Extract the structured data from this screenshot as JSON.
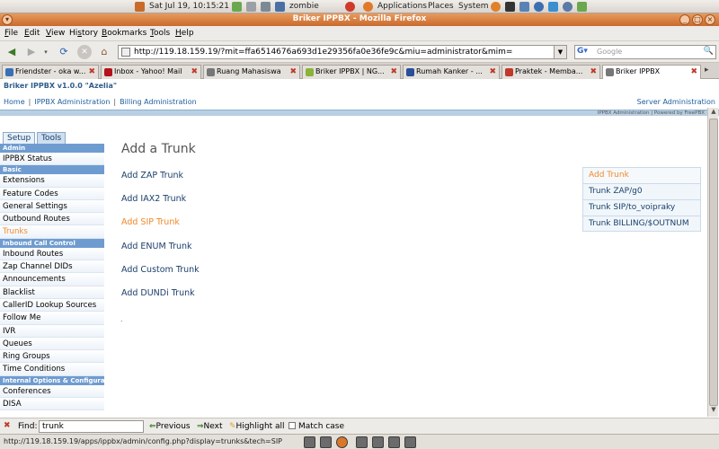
{
  "gnome_panel": {
    "clock": "Sat Jul 19, 10:15:21",
    "user": "zombie",
    "menus": [
      "Applications",
      "Places",
      "System"
    ]
  },
  "window": {
    "title": "Briker IPPBX - Mozilla Firefox"
  },
  "menubar": [
    "File",
    "Edit",
    "View",
    "History",
    "Bookmarks",
    "Tools",
    "Help"
  ],
  "menubar_mnemonics": [
    "F",
    "E",
    "V",
    "s",
    "B",
    "T",
    "H"
  ],
  "navbar": {
    "url": "http://119.18.159.19/?mit=ffa6514676a693d1e29356fa0e36fe9c&miu=administrator&mim=",
    "search_placeholder": "Google"
  },
  "tabs": [
    {
      "label": "Friendster - oka w...",
      "favicon_color": "#3a6fb5"
    },
    {
      "label": "Inbox - Yahoo! Mail",
      "favicon_color": "#b5121b"
    },
    {
      "label": "Ruang Mahasiswa",
      "favicon_color": "#777777"
    },
    {
      "label": "Briker IPPBX | NG...",
      "favicon_color": "#8bb33a"
    },
    {
      "label": "Rumah Kanker - ...",
      "favicon_color": "#2a4e9a"
    },
    {
      "label": "Praktek - Memba...",
      "favicon_color": "#c0392b"
    },
    {
      "label": "Briker IPPBX",
      "favicon_color": "#777777",
      "active": true
    }
  ],
  "page": {
    "brand": "Briker IPPBX v1.0.0 \"Azelia\"",
    "topnav": [
      "Home",
      "IPPBX Administration",
      "Billing Administration"
    ],
    "server_admin": "Server Administration",
    "powered_by": "IPPBX Administration | Powered by FreePBX",
    "left_tabs": [
      "Setup",
      "Tools"
    ],
    "sidebar": [
      {
        "type": "head",
        "label": "Admin"
      },
      {
        "type": "item",
        "label": "IPPBX Status"
      },
      {
        "type": "head",
        "label": "Basic"
      },
      {
        "type": "item",
        "label": "Extensions"
      },
      {
        "type": "item",
        "label": "Feature Codes"
      },
      {
        "type": "item",
        "label": "General Settings"
      },
      {
        "type": "item",
        "label": "Outbound Routes"
      },
      {
        "type": "item",
        "label": "Trunks",
        "active": true
      },
      {
        "type": "head",
        "label": "Inbound Call Control"
      },
      {
        "type": "item",
        "label": "Inbound Routes"
      },
      {
        "type": "item",
        "label": "Zap Channel DIDs"
      },
      {
        "type": "item",
        "label": "Announcements"
      },
      {
        "type": "item",
        "label": "Blacklist"
      },
      {
        "type": "item",
        "label": "CallerID Lookup Sources"
      },
      {
        "type": "item",
        "label": "Follow Me"
      },
      {
        "type": "item",
        "label": "IVR"
      },
      {
        "type": "item",
        "label": "Queues"
      },
      {
        "type": "item",
        "label": "Ring Groups"
      },
      {
        "type": "item",
        "label": "Time Conditions"
      },
      {
        "type": "head",
        "label": "Internal Options & Configuration"
      },
      {
        "type": "item",
        "label": "Conferences"
      },
      {
        "type": "item",
        "label": "DISA"
      }
    ],
    "main_title": "Add a Trunk",
    "add_links": [
      {
        "label": "Add ZAP Trunk"
      },
      {
        "label": "Add IAX2 Trunk"
      },
      {
        "label": "Add SIP Trunk",
        "active": true
      },
      {
        "label": "Add ENUM Trunk"
      },
      {
        "label": "Add Custom Trunk"
      },
      {
        "label": "Add DUNDi Trunk"
      }
    ],
    "dot": ".",
    "right_nav": [
      {
        "label": "Add Trunk",
        "active": true
      },
      {
        "label": "Trunk ZAP/g0"
      },
      {
        "label": "Trunk SIP/to_voipraky"
      },
      {
        "label": "Trunk BILLING/$OUTNUM"
      }
    ]
  },
  "findbar": {
    "label": "Find:",
    "value": "trunk",
    "previous": "Previous",
    "next": "Next",
    "highlight": "Highlight all",
    "match_case": "Match case"
  },
  "statusbar": {
    "text": "http://119.18.159.19/apps/ippbx/admin/config.php?display=trunks&tech=SIP"
  }
}
